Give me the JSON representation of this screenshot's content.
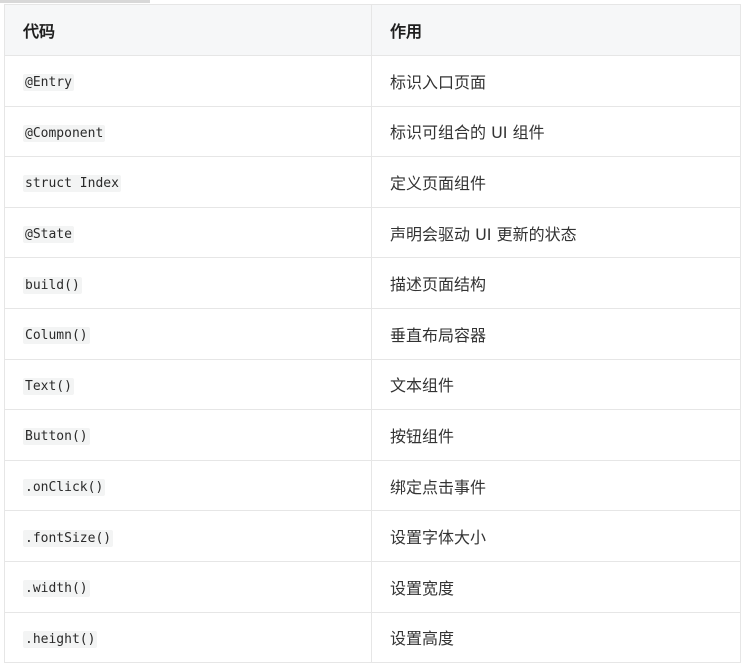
{
  "table": {
    "headers": [
      "代码",
      "作用"
    ],
    "rows": [
      {
        "code": "@Entry",
        "desc": "标识入口页面"
      },
      {
        "code": "@Component",
        "desc": "标识可组合的 UI 组件"
      },
      {
        "code": "struct Index",
        "desc": "定义页面组件"
      },
      {
        "code": "@State",
        "desc": "声明会驱动 UI 更新的状态"
      },
      {
        "code": "build()",
        "desc": "描述页面结构"
      },
      {
        "code": "Column()",
        "desc": "垂直布局容器"
      },
      {
        "code": "Text()",
        "desc": "文本组件"
      },
      {
        "code": "Button()",
        "desc": "按钮组件"
      },
      {
        "code": ".onClick()",
        "desc": "绑定点击事件"
      },
      {
        "code": ".fontSize()",
        "desc": "设置字体大小"
      },
      {
        "code": ".width()",
        "desc": "设置宽度"
      },
      {
        "code": ".height()",
        "desc": "设置高度"
      }
    ]
  }
}
